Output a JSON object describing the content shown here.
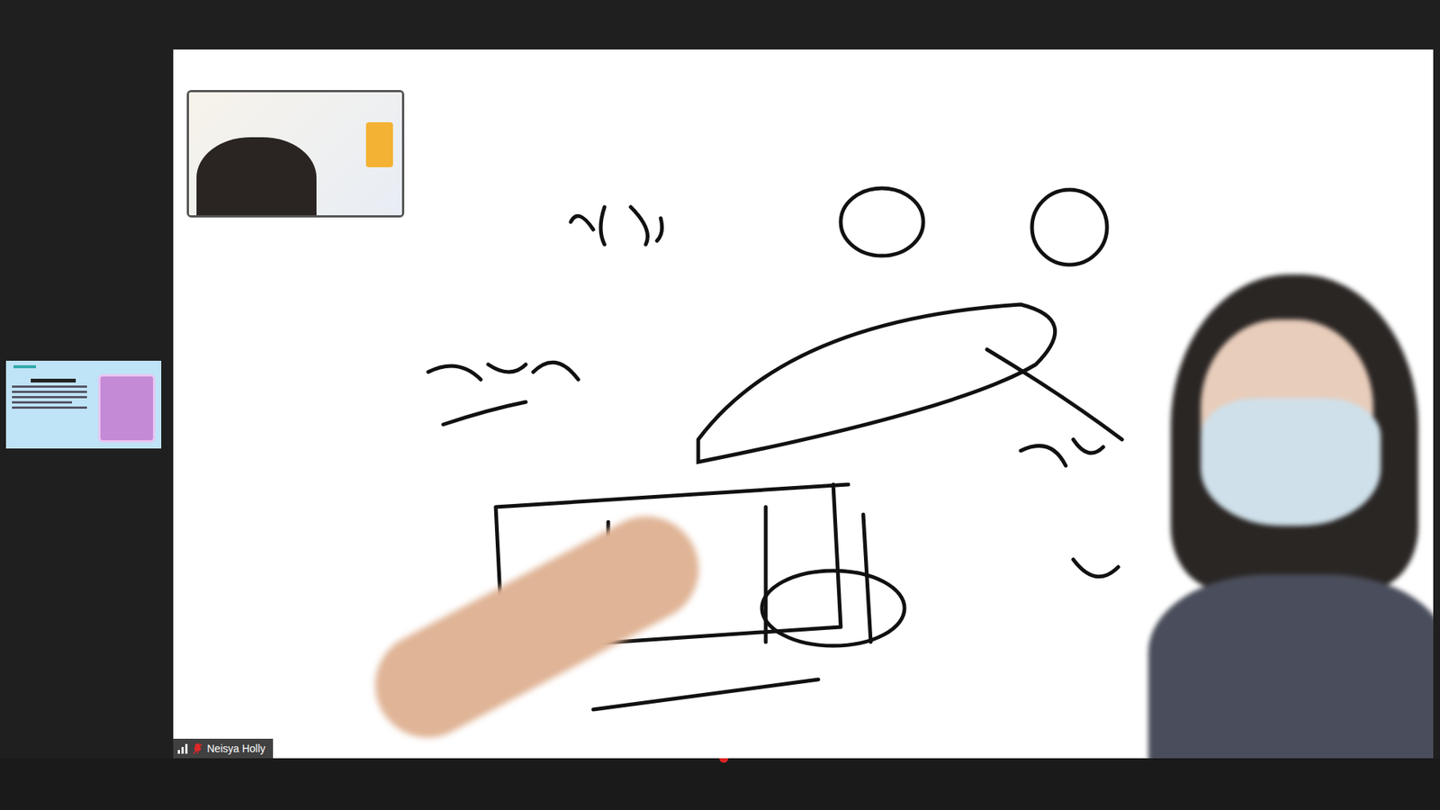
{
  "main_video": {
    "name": "Neisya Holly",
    "muted": true,
    "signal_level": 1
  }
}
